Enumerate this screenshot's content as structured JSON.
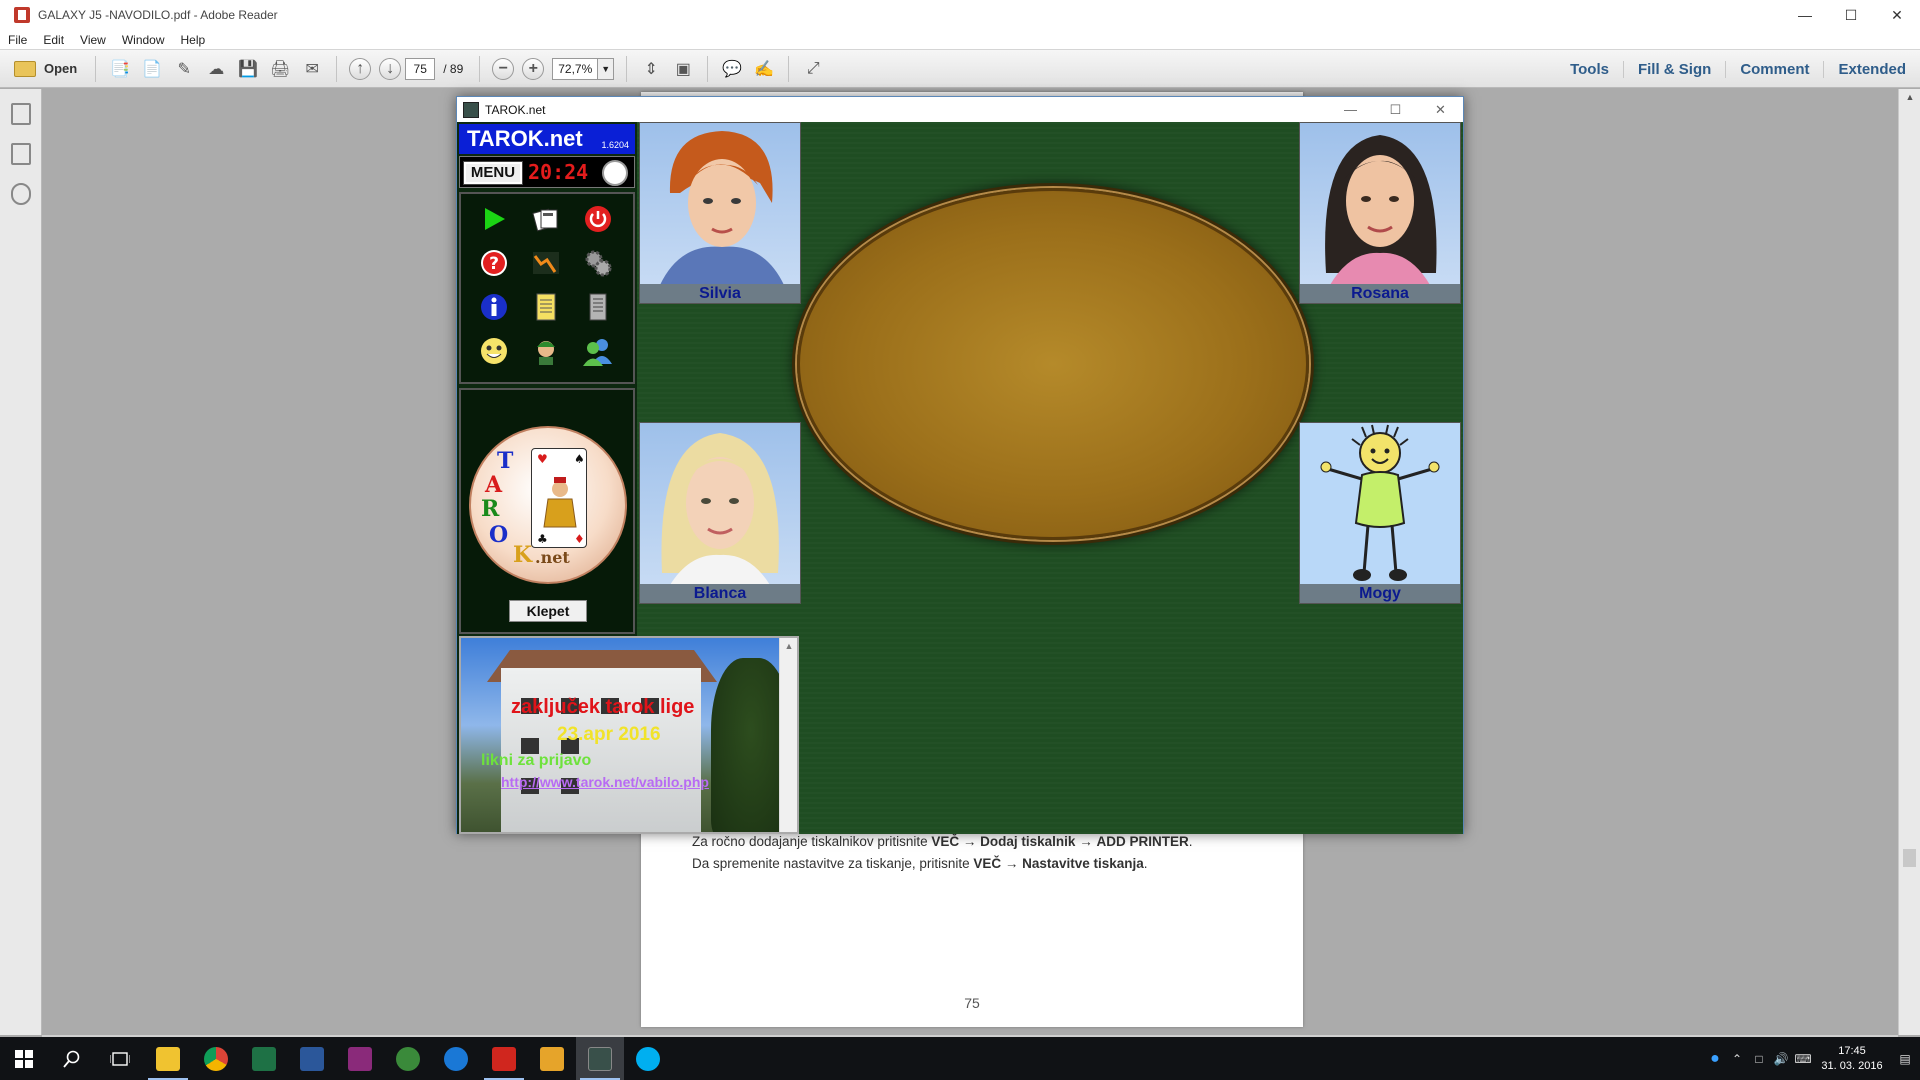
{
  "reader": {
    "title": "GALAXY J5 -NAVODILO.pdf - Adobe Reader",
    "menu": [
      "File",
      "Edit",
      "View",
      "Window",
      "Help"
    ],
    "toolbar": {
      "open_label": "Open",
      "page_current": "75",
      "page_total": "/ 89",
      "zoom": "72,7%",
      "right_links": [
        "Tools",
        "Fill & Sign",
        "Comment",
        "Extended"
      ]
    },
    "pdf": {
      "line1_a": "Za ročno dodajanje tiskalnikov pritisnite ",
      "line1_b": "VEČ",
      "line1_c": " → ",
      "line1_d": "Dodaj tiskalnik",
      "line1_e": " → ",
      "line1_f": "ADD PRINTER",
      "line1_g": ".",
      "line2_a": "Da spremenite nastavitve za tiskanje, pritisnite ",
      "line2_b": "VEČ",
      "line2_c": " → ",
      "line2_d": "Nastavitve tiskanja",
      "line2_e": ".",
      "page_number": "75"
    }
  },
  "tarok": {
    "window_title": "TAROK.net",
    "brand": "TAROK.net",
    "version": "1.6204",
    "menu_label": "MENU",
    "clock": "20:24",
    "logo_letters": [
      "T",
      "A",
      "R",
      "O",
      "K"
    ],
    "logo_suffix": ".net",
    "chat_label": "Klepet",
    "ad": {
      "headline": "zaključek tarok lige",
      "date": "23.apr 2016",
      "cta": "likni za prijavo",
      "url": "http://www.tarok.net/vabilo.php"
    },
    "players": {
      "top_left": "Silvia",
      "top_right": "Rosana",
      "bottom_left": "Blanca",
      "bottom_right": "Mogy"
    },
    "colors": {
      "felt": "#1f4d22",
      "brand_bg": "#0a1fd6",
      "clock": "#e31c1c",
      "name_text": "#0b1a8f",
      "ad_headline": "#e0141a",
      "ad_date": "#f1e32a",
      "ad_cta": "#6ee23c",
      "ad_url": "#b86bf3"
    }
  },
  "taskbar": {
    "time": "17:45",
    "date": "31. 03. 2016"
  }
}
